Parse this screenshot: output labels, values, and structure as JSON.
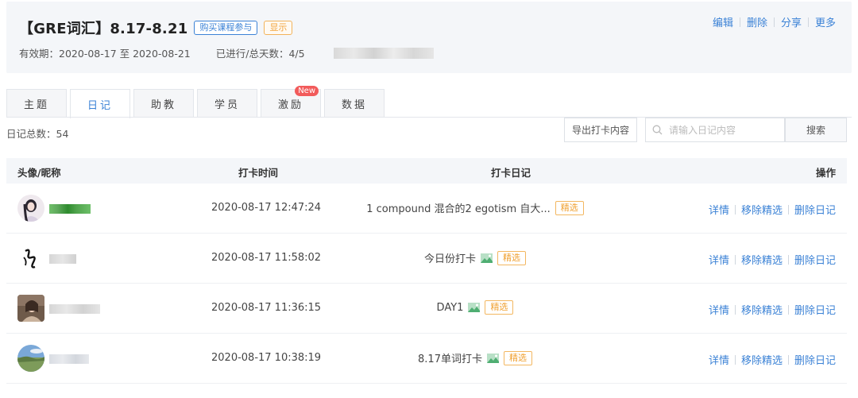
{
  "header": {
    "title": "【GRE词汇】8.17-8.21",
    "tag_buy": "购买课程参与",
    "tag_show": "显示",
    "validity": "有效期：2020-08-17 至 2020-08-21",
    "progress": "已进行/总天数：4/5",
    "actions": {
      "edit": "编辑",
      "delete": "删除",
      "share": "分享",
      "more": "更多"
    }
  },
  "tabs": [
    {
      "label": "主题"
    },
    {
      "label": "日记"
    },
    {
      "label": "助教"
    },
    {
      "label": "学员"
    },
    {
      "label": "激励",
      "badge": "New"
    },
    {
      "label": "数据"
    }
  ],
  "toolbar": {
    "diary_count": "日记总数：54",
    "export_label": "导出打卡内容",
    "search_placeholder": "请输入日记内容",
    "search_label": "搜索"
  },
  "table": {
    "columns": {
      "avatar_nick": "头像/昵称",
      "time": "打卡时间",
      "diary": "打卡日记",
      "ops": "操作"
    },
    "rows": [
      {
        "time": "2020-08-17 12:47:24",
        "diary": "1 compound 混合的2 egotism 自大...",
        "featured": "精选",
        "has_image": false
      },
      {
        "time": "2020-08-17 11:58:02",
        "diary": "今日份打卡",
        "featured": "精选",
        "has_image": true
      },
      {
        "time": "2020-08-17 11:36:15",
        "diary": "DAY1",
        "featured": "精选",
        "has_image": true
      },
      {
        "time": "2020-08-17 10:38:19",
        "diary": "8.17单词打卡",
        "featured": "精选",
        "has_image": true
      }
    ],
    "ops": {
      "detail": "详情",
      "remove_featured": "移除精选",
      "delete_diary": "删除日记"
    }
  },
  "colors": {
    "accent": "#3b82d6",
    "featured": "#f0a132",
    "badge": "#f25b5b"
  }
}
